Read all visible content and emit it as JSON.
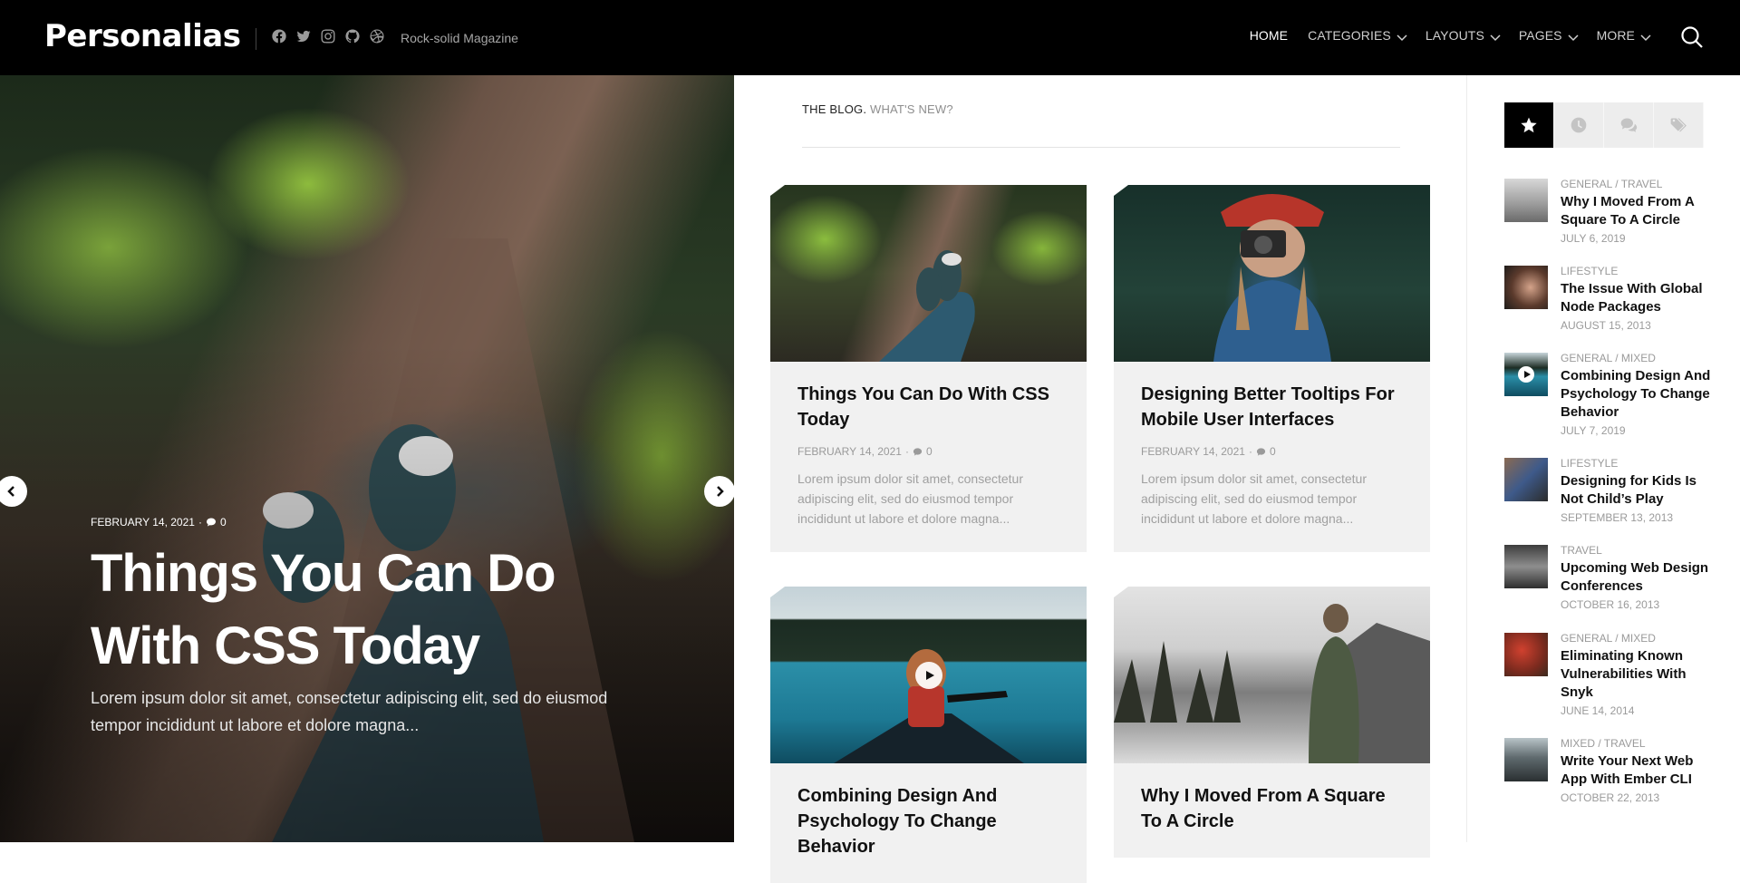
{
  "site": {
    "logo": "Personalias",
    "tagline": "Rock-solid Magazine",
    "socials": [
      "facebook-icon",
      "twitter-icon",
      "instagram-icon",
      "github-icon",
      "dribbble-icon"
    ]
  },
  "nav": {
    "items": [
      {
        "label": "HOME",
        "active": true,
        "dropdown": false
      },
      {
        "label": "CATEGORIES",
        "active": false,
        "dropdown": true
      },
      {
        "label": "LAYOUTS",
        "active": false,
        "dropdown": true
      },
      {
        "label": "PAGES",
        "active": false,
        "dropdown": true
      },
      {
        "label": "MORE",
        "active": false,
        "dropdown": true
      }
    ]
  },
  "hero": {
    "date": "FEBRUARY 14, 2021",
    "comments": "0",
    "title": "Things You Can Do With CSS Today",
    "excerpt": "Lorem ipsum dolor sit amet, consectetur adipiscing elit, sed do eiusmod tempor incididunt ut labore et dolore magna..."
  },
  "blog": {
    "heading": "THE BLOG.",
    "subheading": "WHAT'S NEW?",
    "posts": [
      {
        "title": "Things You Can Do With CSS Today",
        "date": "FEBRUARY 14, 2021",
        "comments": "0",
        "excerpt": "Lorem ipsum dolor sit amet, consectetur adipiscing elit, sed do eiusmod tempor incididunt ut labore et dolore magna..."
      },
      {
        "title": "Designing Better Tooltips For Mobile User Interfaces",
        "date": "FEBRUARY 14, 2021",
        "comments": "0",
        "excerpt": "Lorem ipsum dolor sit amet, consectetur adipiscing elit, sed do eiusmod tempor incididunt ut labore et dolore magna..."
      },
      {
        "title": "Combining Design And Psychology To Change Behavior"
      },
      {
        "title": "Why I Moved From A Square To A Circle"
      }
    ]
  },
  "sidebar": {
    "tabs": [
      "star-icon",
      "clock-icon",
      "comments-icon",
      "tags-icon"
    ],
    "items": [
      {
        "category": "GENERAL / TRAVEL",
        "title": "Why I Moved From A Square To A Circle",
        "date": "JULY 6, 2019"
      },
      {
        "category": "LIFESTYLE",
        "title": "The Issue With Global Node Packages",
        "date": "AUGUST 15, 2013"
      },
      {
        "category": "GENERAL / MIXED",
        "title": "Combining Design And Psychology To Change Behavior",
        "date": "JULY 7, 2019"
      },
      {
        "category": "LIFESTYLE",
        "title": "Designing for Kids Is Not Child’s Play",
        "date": "SEPTEMBER 13, 2013"
      },
      {
        "category": "TRAVEL",
        "title": "Upcoming Web Design Conferences",
        "date": "OCTOBER 16, 2013"
      },
      {
        "category": "GENERAL / MIXED",
        "title": "Eliminating Known Vulnerabilities With Snyk",
        "date": "JUNE 14, 2014"
      },
      {
        "category": "MIXED / TRAVEL",
        "title": "Write Your Next Web App With Ember CLI",
        "date": "OCTOBER 22, 2013"
      }
    ]
  }
}
